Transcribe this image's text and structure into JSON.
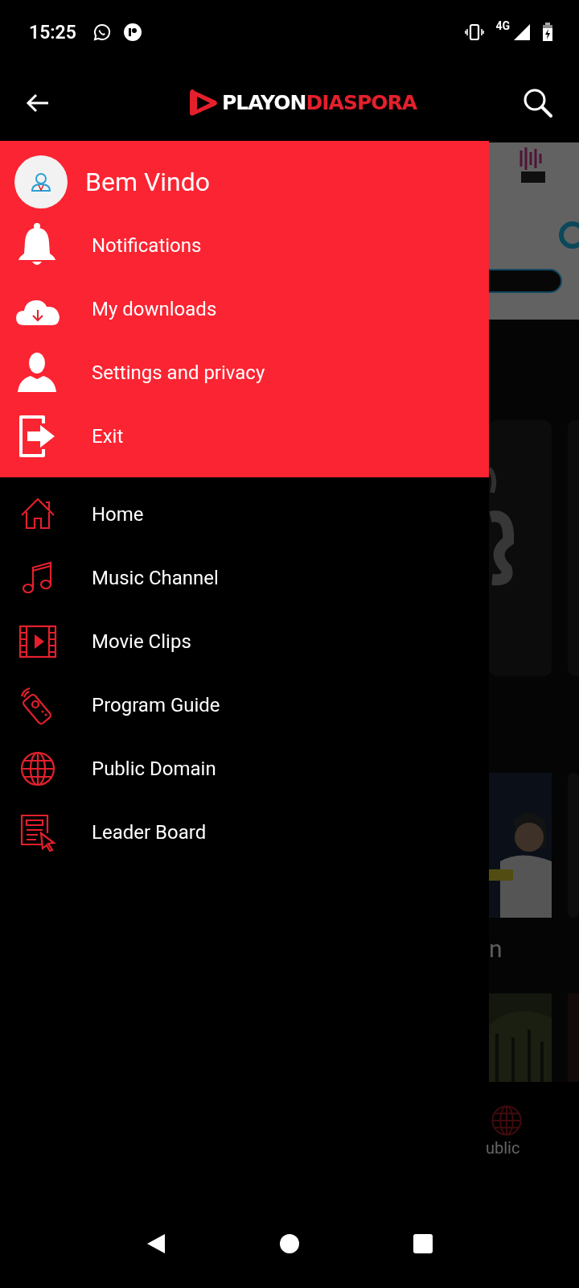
{
  "status_bar": {
    "time": "15:25",
    "network": "4G"
  },
  "app_bar": {
    "logo_primary": "PLAYON",
    "logo_accent": "DIASPORA"
  },
  "drawer": {
    "greeting": "Bem Vindo",
    "account_items": [
      {
        "label": "Notifications"
      },
      {
        "label": "My downloads"
      },
      {
        "label": "Settings and privacy"
      },
      {
        "label": "Exit"
      }
    ],
    "menu_items": [
      {
        "label": "Home"
      },
      {
        "label": "Music Channel"
      },
      {
        "label": "Movie Clips"
      },
      {
        "label": "Program Guide"
      },
      {
        "label": "Public Domain"
      },
      {
        "label": "Leader Board"
      }
    ]
  },
  "background": {
    "section_title": "n",
    "bottom_nav_label": "ublic"
  }
}
